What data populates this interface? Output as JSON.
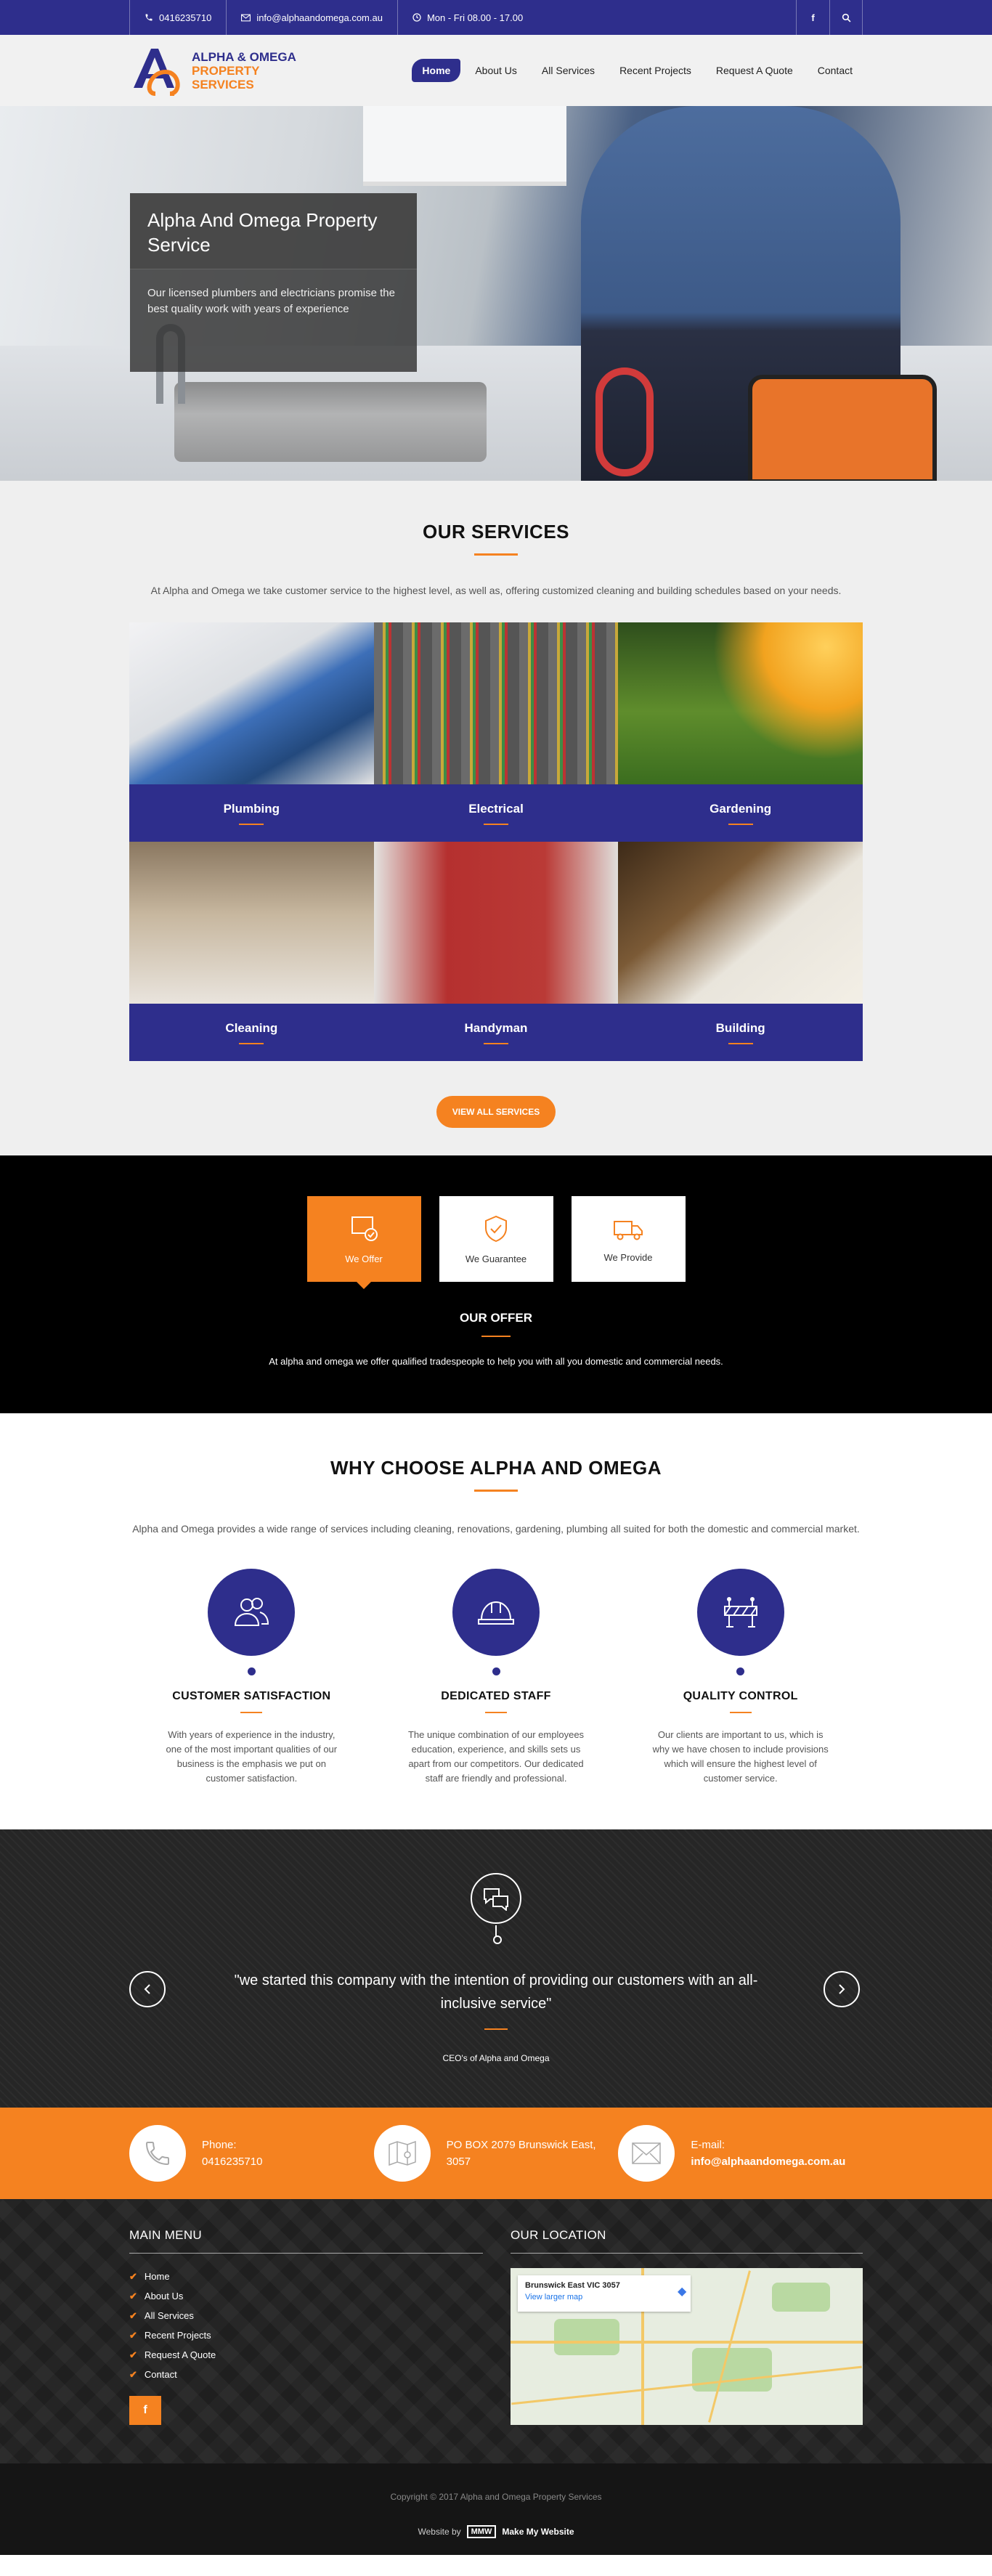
{
  "topbar": {
    "phone": "0416235710",
    "email": "info@alphaandomega.com.au",
    "hours": "Mon - Fri 08.00 - 17.00",
    "facebook_label": "f"
  },
  "header": {
    "logo_line1": "ALPHA & OMEGA",
    "logo_line2": "PROPERTY",
    "logo_line3": "SERVICES",
    "nav": [
      "Home",
      "About Us",
      "All Services",
      "Recent Projects",
      "Request A Quote",
      "Contact"
    ]
  },
  "hero": {
    "title": "Alpha And Omega Property Service",
    "text": "Our licensed plumbers and electricians promise the best quality work with years of experience"
  },
  "services": {
    "title": "OUR SERVICES",
    "intro": "At Alpha and Omega we take customer service to the highest level, as well as, offering customized cleaning and building schedules based on your needs.",
    "items": [
      "Plumbing",
      "Electrical",
      "Gardening",
      "Cleaning",
      "Handyman",
      "Building"
    ],
    "button": "VIEW ALL SERVICES"
  },
  "offer": {
    "tabs": [
      "We Offer",
      "We Guarantee",
      "We Provide"
    ],
    "title": "OUR OFFER",
    "text": "At alpha and omega we offer qualified tradespeople to help you with all you domestic and commercial needs."
  },
  "why": {
    "title": "WHY CHOOSE ALPHA AND OMEGA",
    "intro": "Alpha and Omega provides a wide range of services including cleaning, renovations, gardening, plumbing all suited for both the domestic and commercial market.",
    "features": [
      {
        "title": "CUSTOMER SATISFACTION",
        "text": "With years of experience in the industry, one of the most important qualities of our business is the emphasis we put on customer satisfaction.",
        "icon": "users-icon"
      },
      {
        "title": "DEDICATED STAFF",
        "text": "The unique combination of our employees education, experience, and skills sets us apart from our competitors. Our dedicated staff are friendly and professional.",
        "icon": "hard-hat-icon"
      },
      {
        "title": "QUALITY CONTROL",
        "text": "Our clients are important to us, which is why we have chosen to include provisions which will ensure the highest level of customer service.",
        "icon": "barrier-icon"
      }
    ]
  },
  "quote": {
    "text": "\"we started this company with the intention of providing our customers with an all- inclusive service\"",
    "author": "CEO's of Alpha and Omega"
  },
  "contacts": {
    "phone_label": "Phone:",
    "phone": "0416235710",
    "address": "PO BOX 2079 Brunswick East, 3057",
    "email_label": "E-mail:",
    "email": "info@alphaandomega.com.au"
  },
  "footer": {
    "menu_title": "MAIN MENU",
    "menu": [
      "Home",
      "About Us",
      "All Services",
      "Recent Projects",
      "Request A Quote",
      "Contact"
    ],
    "location_title": "OUR LOCATION",
    "map_place": "Brunswick East VIC 3057",
    "map_link": "View larger map",
    "copyright": "Copyright © 2017 Alpha and Omega Property Services",
    "website_by": "Website by",
    "website_by_brand": "Make My Website"
  },
  "colors": {
    "primary": "#2e2e8c",
    "accent": "#f58220"
  }
}
